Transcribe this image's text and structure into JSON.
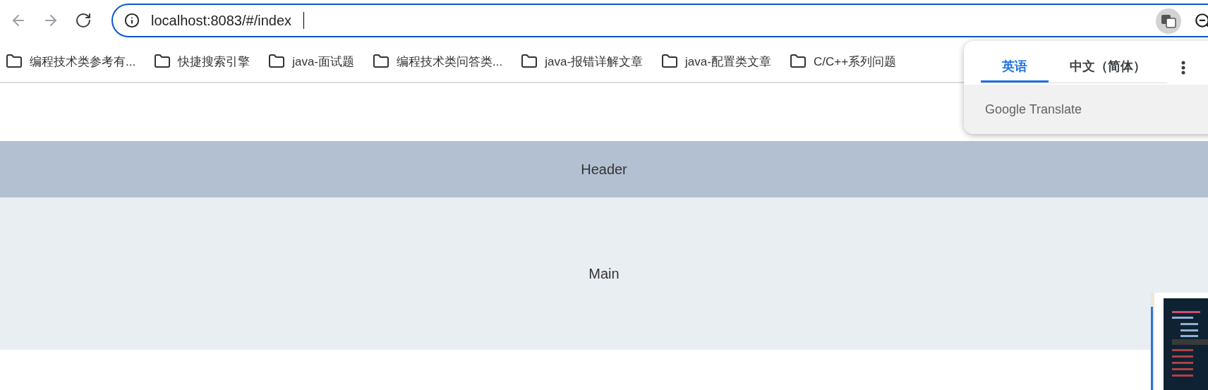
{
  "toolbar": {
    "nav_buttons": [
      {
        "kind": "back",
        "disabled": true
      },
      {
        "kind": "forward",
        "disabled": true
      },
      {
        "kind": "reload",
        "disabled": false
      }
    ],
    "address_bar": {
      "value": "localhost:8083/#/index",
      "focused": true
    }
  },
  "bookmarks": [
    "编程技术类参考有...",
    "快捷搜索引擎",
    "java-面试题",
    "编程技术类问答类...",
    "java-报错详解文章",
    "java-配置类文章",
    "C/C++系列问题"
  ],
  "translate_popup": {
    "tabs": [
      {
        "label": "英语",
        "selected": true
      },
      {
        "label": "中文（简体）",
        "selected": false
      }
    ],
    "brand": "Google Translate"
  },
  "page": {
    "header": "Header",
    "main": "Main"
  }
}
